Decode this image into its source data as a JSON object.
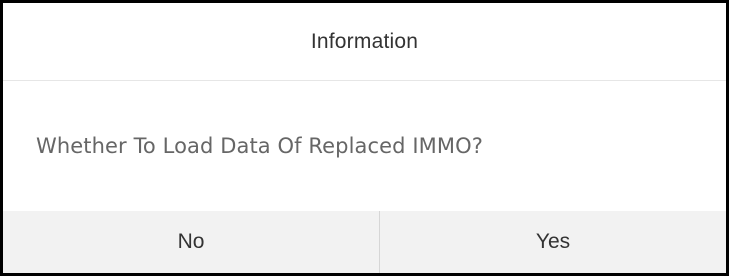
{
  "dialog": {
    "title": "Information",
    "message": "Whether To Load Data Of Replaced IMMO?",
    "buttons": {
      "no_label": "No",
      "yes_label": "Yes"
    }
  },
  "colors": {
    "frame": "#000000",
    "dialog_background": "#ffffff",
    "footer_background": "#f2f2f2",
    "title_text": "#333333",
    "message_text": "#666666",
    "divider": "#d6d6d6"
  }
}
